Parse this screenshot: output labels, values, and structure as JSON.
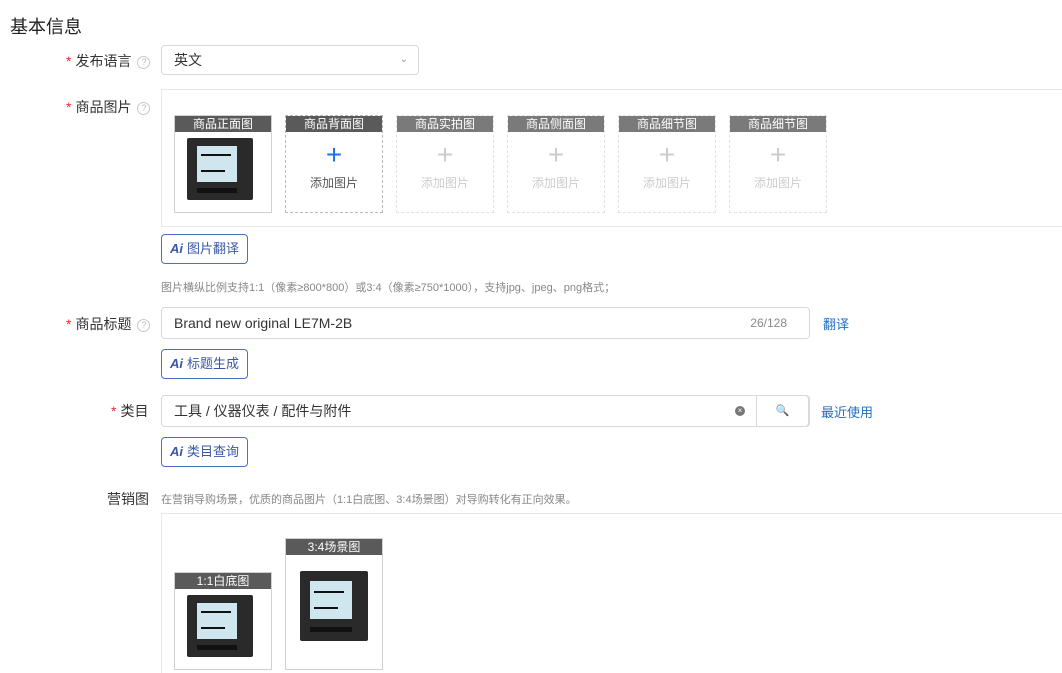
{
  "section_title": "基本信息",
  "language": {
    "label": "发布语言",
    "value": "英文",
    "help": "?"
  },
  "images": {
    "label": "商品图片",
    "help": "?",
    "slots": [
      {
        "tag": "商品正面图"
      },
      {
        "tag": "商品背面图",
        "add_text": "添加图片"
      },
      {
        "tag": "商品实拍图",
        "add_text": "添加图片"
      },
      {
        "tag": "商品侧面图",
        "add_text": "添加图片"
      },
      {
        "tag": "商品细节图",
        "add_text": "添加图片"
      },
      {
        "tag": "商品细节图",
        "add_text": "添加图片"
      }
    ],
    "plus_glyph": "+",
    "ai_prefix": "Ai",
    "translate_button": "图片翻译",
    "hint": "图片横纵比例支持1:1（像素≥800*800）或3:4（像素≥750*1000），支持jpg、jpeg、png格式；"
  },
  "title": {
    "label": "商品标题",
    "help": "?",
    "value": "Brand new original LE7M-2B",
    "counter": "26/128",
    "translate_link": "翻译",
    "generate_button": "标题生成"
  },
  "category": {
    "label": "类目",
    "value": "工具 / 仪器仪表 / 配件与附件",
    "clear_glyph": "×",
    "search_glyph": "🔍",
    "recent_link": "最近使用",
    "query_button": "类目查询"
  },
  "marketing": {
    "label": "营销图",
    "hint": "在营销导购场景，优质的商品图片（1:1白底图、3:4场景图）对导购转化有正向效果。",
    "slots": [
      {
        "tag": "1:1白底图"
      },
      {
        "tag": "3:4场景图"
      }
    ]
  },
  "required_mark": "*",
  "chevron": "⌄",
  "colors": {
    "accent": "#1f6dc4",
    "ai_border": "#4b6ec7",
    "required": "#f5222d",
    "tag_bg": "#5a5a5a"
  }
}
